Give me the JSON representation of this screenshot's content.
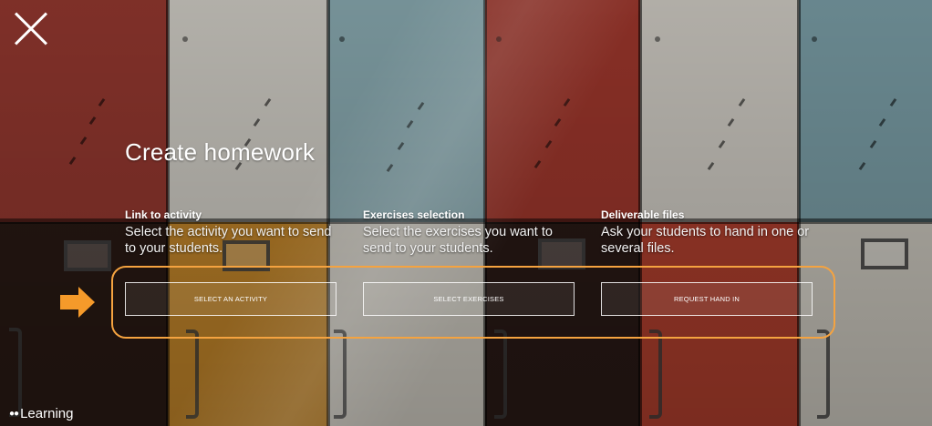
{
  "colors": {
    "accent": "#f5a340",
    "arrow": "#f59a2a"
  },
  "close_icon": "close-x-icon",
  "title": "Create homework",
  "options": [
    {
      "heading": "Link to activity",
      "description": "Select the activity you want to send to your students.",
      "button_label": "SELECT AN ACTIVITY"
    },
    {
      "heading": "Exercises selection",
      "description": "Select the exercises you want to send to your students.",
      "button_label": "SELECT EXERCISES"
    },
    {
      "heading": "Deliverable files",
      "description": "Ask your students to hand in one or several files.",
      "button_label": "REQUEST HAND IN"
    }
  ],
  "brand": {
    "name": "Learning",
    "icon": "dots-logo-icon"
  }
}
